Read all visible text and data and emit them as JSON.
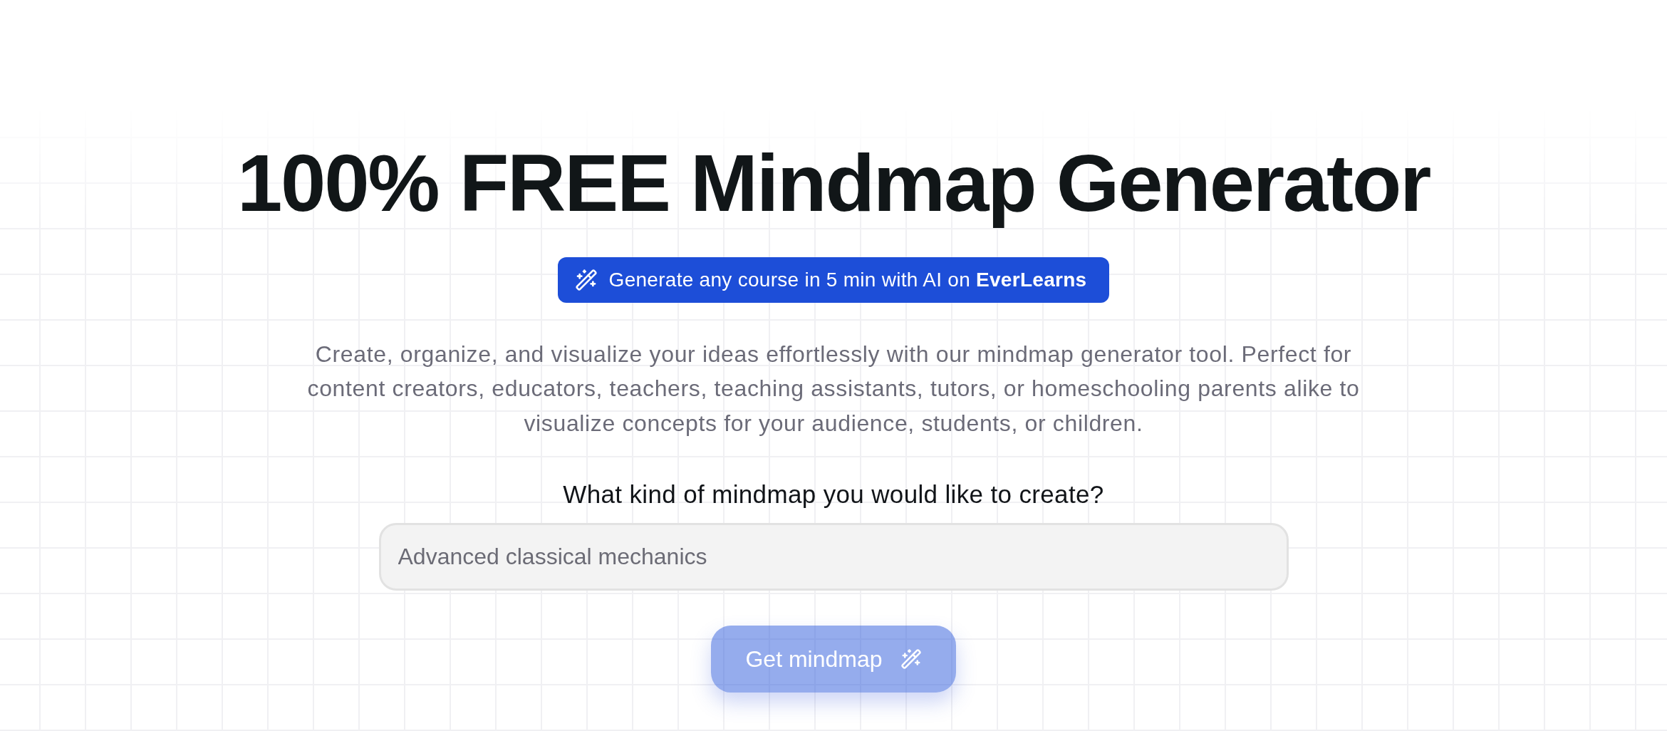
{
  "title": "100% FREE Mindmap Generator",
  "promo_banner": {
    "text": "Generate any course in 5 min with AI on **EverLearns**"
  },
  "description": "Create, organize, and visualize your ideas effortlessly with our mindmap generator tool. Perfect for content creators, educators, teachers, teaching assistants, tutors, or homeschooling parents alike to visualize concepts for your audience, students, or children.",
  "prompt": {
    "label": "What kind of mindmap you would like to create?",
    "placeholder": "Advanced classical mechanics"
  },
  "submit_button": {
    "label": "Get mindmap",
    "disabled": true
  }
}
